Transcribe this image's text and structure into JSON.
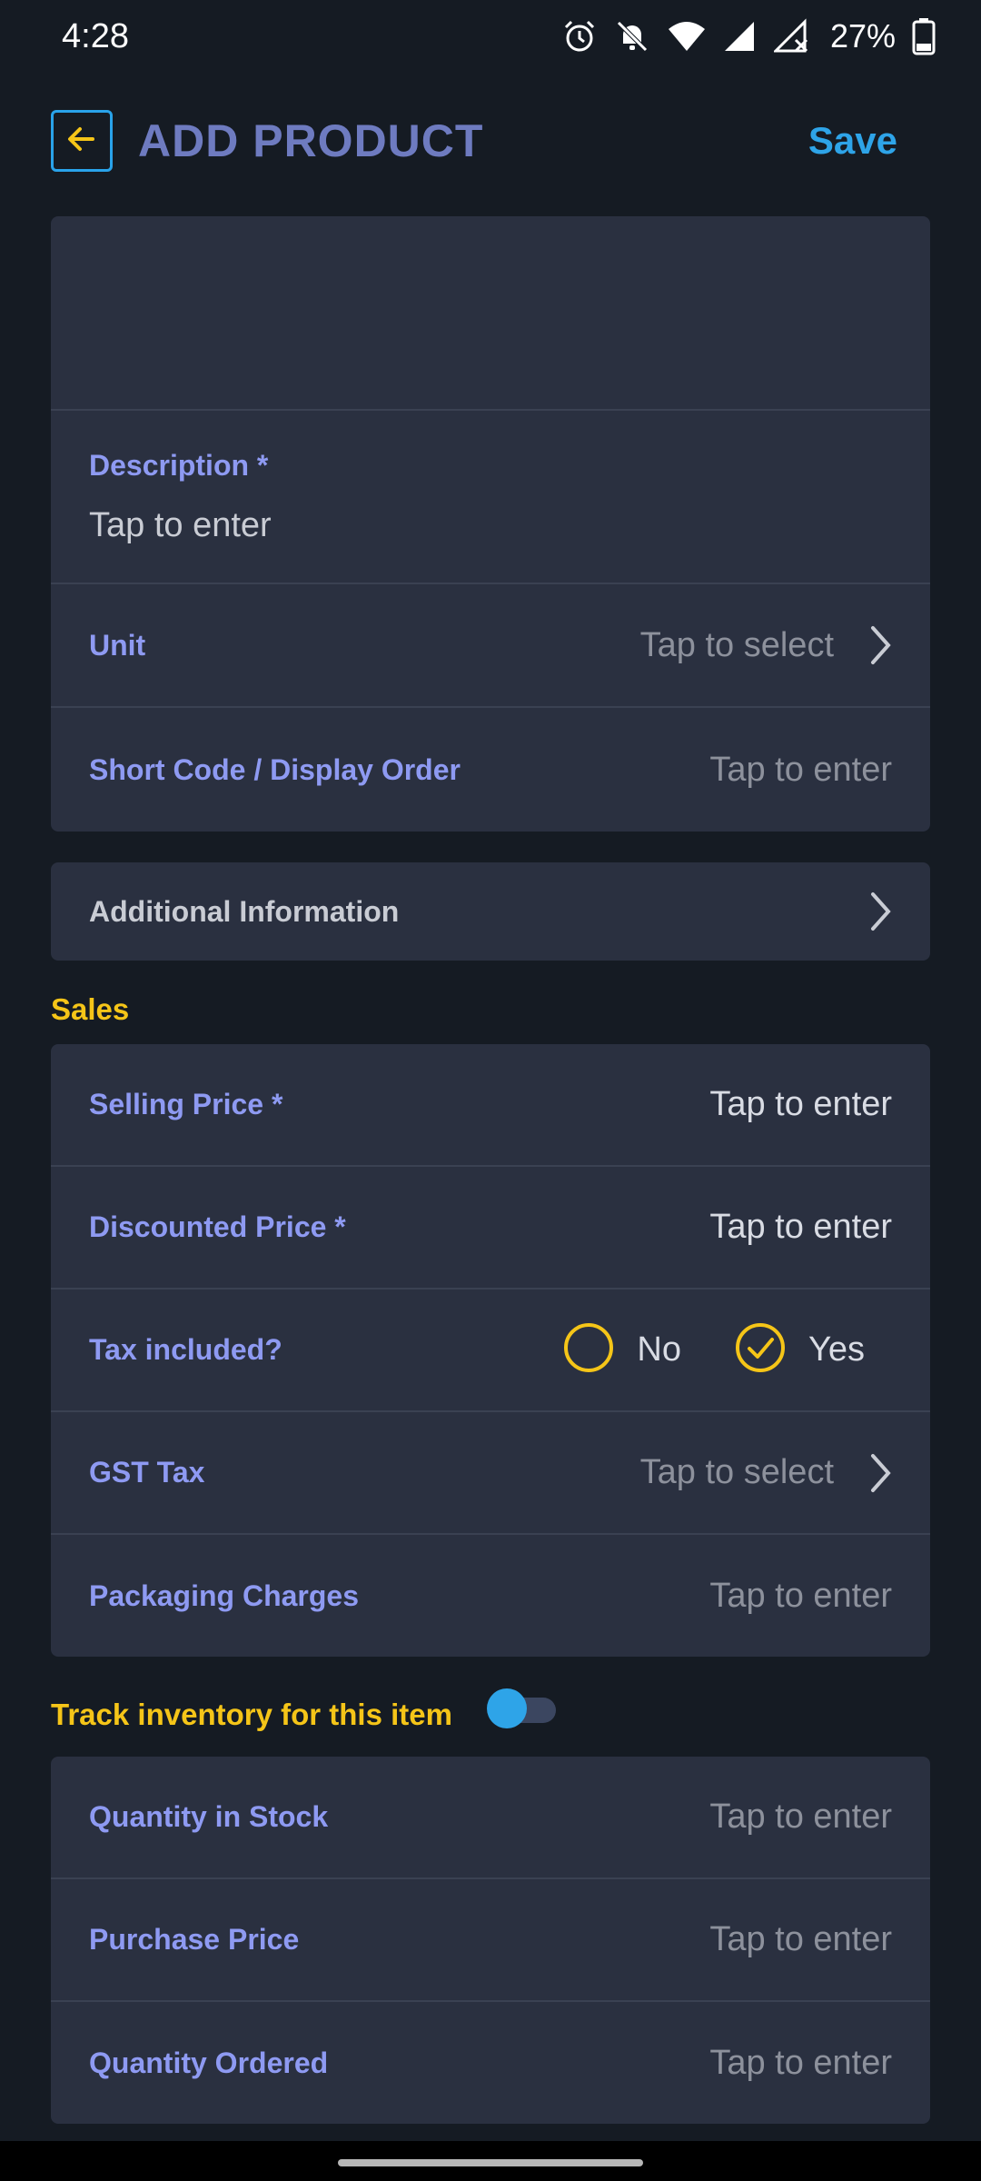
{
  "status_bar": {
    "time": "4:28",
    "battery": "27%",
    "icons": [
      "alarm-icon",
      "bell-off-icon",
      "wifi-icon",
      "signal-icon",
      "signal-off-icon",
      "battery-icon"
    ]
  },
  "app_bar": {
    "title": "ADD PRODUCT",
    "save_label": "Save",
    "back_icon": "arrow-left-icon"
  },
  "basic_card": {
    "description": {
      "label": "Description *",
      "placeholder": "Tap to enter"
    },
    "unit": {
      "label": "Unit",
      "placeholder": "Tap to select"
    },
    "short_code": {
      "label": "Short Code / Display Order",
      "placeholder": "Tap to enter"
    }
  },
  "additional_info": {
    "label": "Additional Information"
  },
  "sales": {
    "title": "Sales",
    "selling_price": {
      "label": "Selling Price *",
      "placeholder": "Tap to enter"
    },
    "discounted_price": {
      "label": "Discounted Price *",
      "placeholder": "Tap to enter"
    },
    "tax_included": {
      "label": "Tax included?",
      "no_label": "No",
      "yes_label": "Yes",
      "selected": "Yes"
    },
    "gst_tax": {
      "label": "GST Tax",
      "placeholder": "Tap to select"
    },
    "packaging": {
      "label": "Packaging Charges",
      "placeholder": "Tap to enter"
    }
  },
  "inventory": {
    "title": "Track inventory for this item",
    "toggle_on": false,
    "quantity_in_stock": {
      "label": "Quantity in Stock",
      "placeholder": "Tap to enter"
    },
    "purchase_price": {
      "label": "Purchase Price",
      "placeholder": "Tap to enter"
    },
    "quantity_ordered": {
      "label": "Quantity Ordered",
      "placeholder": "Tap to enter"
    }
  },
  "colors": {
    "background": "#151b23",
    "card": "#2a3040",
    "label": "#8e9af2",
    "accent_blue": "#2ea4e8",
    "section_yellow": "#f5c518"
  }
}
